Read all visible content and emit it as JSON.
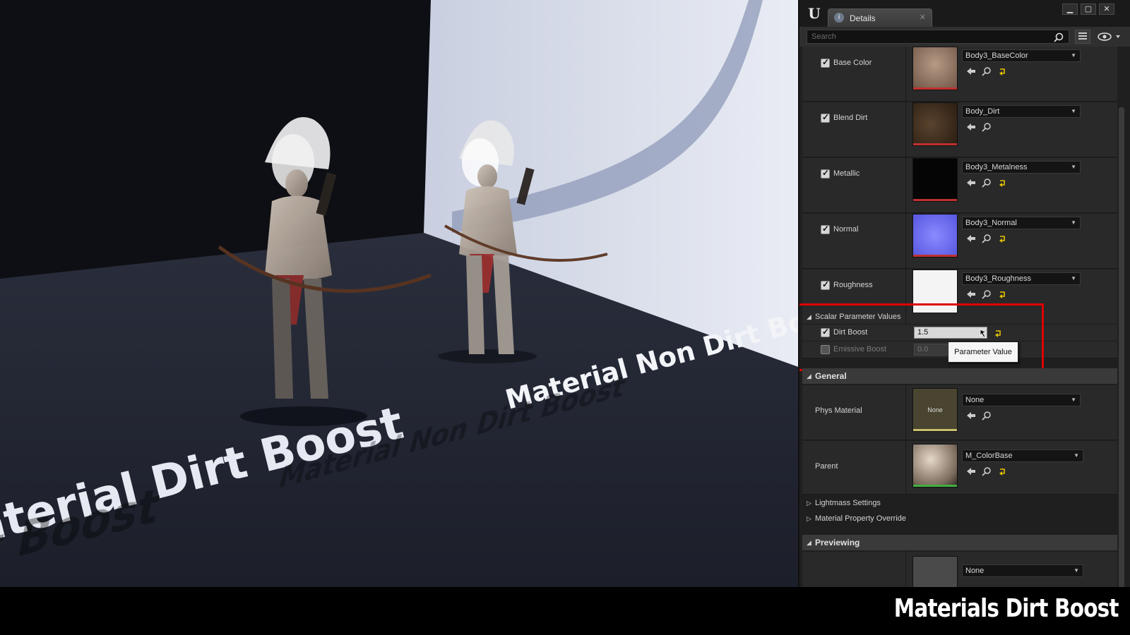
{
  "viewport": {
    "label_left": "aterial Dirt Boost",
    "label_right": "Material Non Dirt Boost"
  },
  "panel": {
    "tab_label": "Details",
    "search_placeholder": "Search",
    "texture_params": [
      {
        "label": "Base Color",
        "checked": true,
        "value": "Body3_BaseColor",
        "thumb_color": "#8a7060",
        "bar_color": "#c03030"
      },
      {
        "label": "Blend Dirt",
        "checked": true,
        "value": "Body_Dirt",
        "thumb_color": "#4a3624",
        "bar_color": "#c03030"
      },
      {
        "label": "Metallic",
        "checked": true,
        "value": "Body3_Metalness",
        "thumb_color": "#0a0a0a",
        "bar_color": "#c03030"
      },
      {
        "label": "Normal",
        "checked": true,
        "value": "Body3_Normal",
        "thumb_color": "#7a7aff",
        "bar_color": "#c03030"
      },
      {
        "label": "Roughness",
        "checked": true,
        "value": "Body3_Roughness",
        "thumb_color": "#f4f4f4",
        "bar_color": "#c03030"
      }
    ],
    "scalar_section": "Scalar Parameter Values",
    "scalars": [
      {
        "label": "Dirt Boost",
        "value": "1.5",
        "enabled": true
      },
      {
        "label": "Emissive Boost",
        "value": "0.0",
        "enabled": false
      }
    ],
    "tooltip": "Parameter Value",
    "general_section": "General",
    "phys_material": {
      "label": "Phys Material",
      "thumb_text": "None",
      "value": "None"
    },
    "parent": {
      "label": "Parent",
      "value": "M_ColorBase"
    },
    "collapsed": [
      "Lightmass Settings",
      "Material Property Override"
    ],
    "previewing_section": "Previewing",
    "preview_value": "None"
  },
  "caption": "Materials Dirt Boost",
  "colors": {
    "highlight": "#e00000",
    "panel_bg": "#262626"
  }
}
